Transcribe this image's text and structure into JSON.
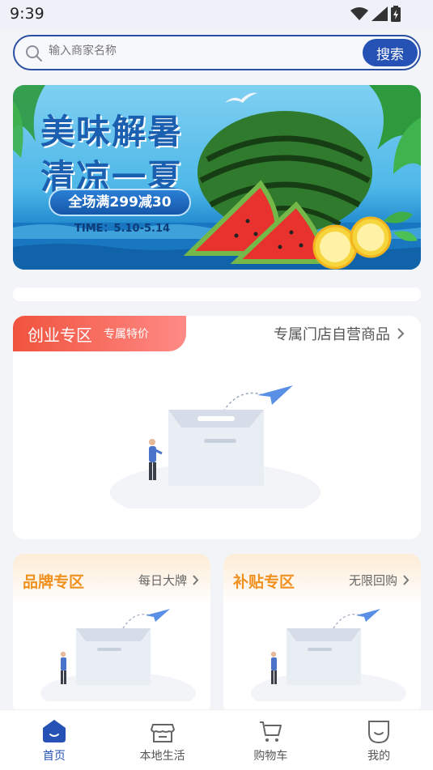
{
  "status": {
    "time": "9:39"
  },
  "search": {
    "placeholder": "输入商家名称",
    "button_label": "搜索"
  },
  "banner": {
    "title_line1": "美味解暑",
    "title_line2": "清凉一夏",
    "promo": "全场满299减30",
    "date": "TIME：5.10-5.14"
  },
  "main_card": {
    "tag_title": "创业专区",
    "tag_subtitle": "专属特价",
    "link_text": "专属门店自营商品"
  },
  "sub_cards": [
    {
      "title": "品牌专区",
      "link_text": "每日大牌"
    },
    {
      "title": "补贴专区",
      "link_text": "无限回购"
    }
  ],
  "tabbar": {
    "items": [
      {
        "label": "首页",
        "icon": "home-icon",
        "active": true
      },
      {
        "label": "本地生活",
        "icon": "store-icon",
        "active": false
      },
      {
        "label": "购物车",
        "icon": "cart-icon",
        "active": false
      },
      {
        "label": "我的",
        "icon": "profile-icon",
        "active": false
      }
    ]
  },
  "colors": {
    "accent": "#2552b4",
    "tag_red": "#f0533d",
    "sub_title_orange": "#f0901f"
  }
}
